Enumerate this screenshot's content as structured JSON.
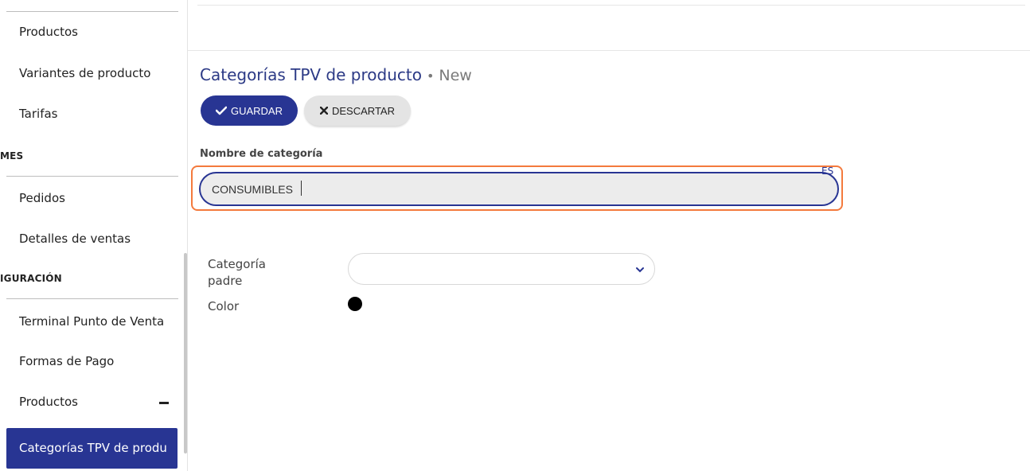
{
  "sidebar": {
    "items_top": [
      "Productos",
      "Variantes de producto",
      "Tarifas"
    ],
    "section_1": "MES",
    "items_mid": [
      "Pedidos",
      "Detalles de ventas"
    ],
    "section_2": "IGURACIÓN",
    "items_bottom": [
      "Terminal Punto de Venta",
      "Formas de Pago",
      "Productos"
    ],
    "active_item": "Categorías TPV de produ"
  },
  "breadcrumb": {
    "title": "Categorías TPV de producto",
    "separator": "•",
    "status": "New"
  },
  "toolbar": {
    "save_label": "GUARDAR",
    "discard_label": "DESCARTAR"
  },
  "form": {
    "name_label": "Nombre de categoría",
    "name_value": "CONSUMIBLES",
    "lang_badge": "ES",
    "parent_label": "Categoría padre",
    "parent_value": "",
    "color_label": "Color",
    "color_value": "#000000"
  },
  "colors": {
    "primary": "#283593",
    "highlight": "#f47a3d"
  }
}
